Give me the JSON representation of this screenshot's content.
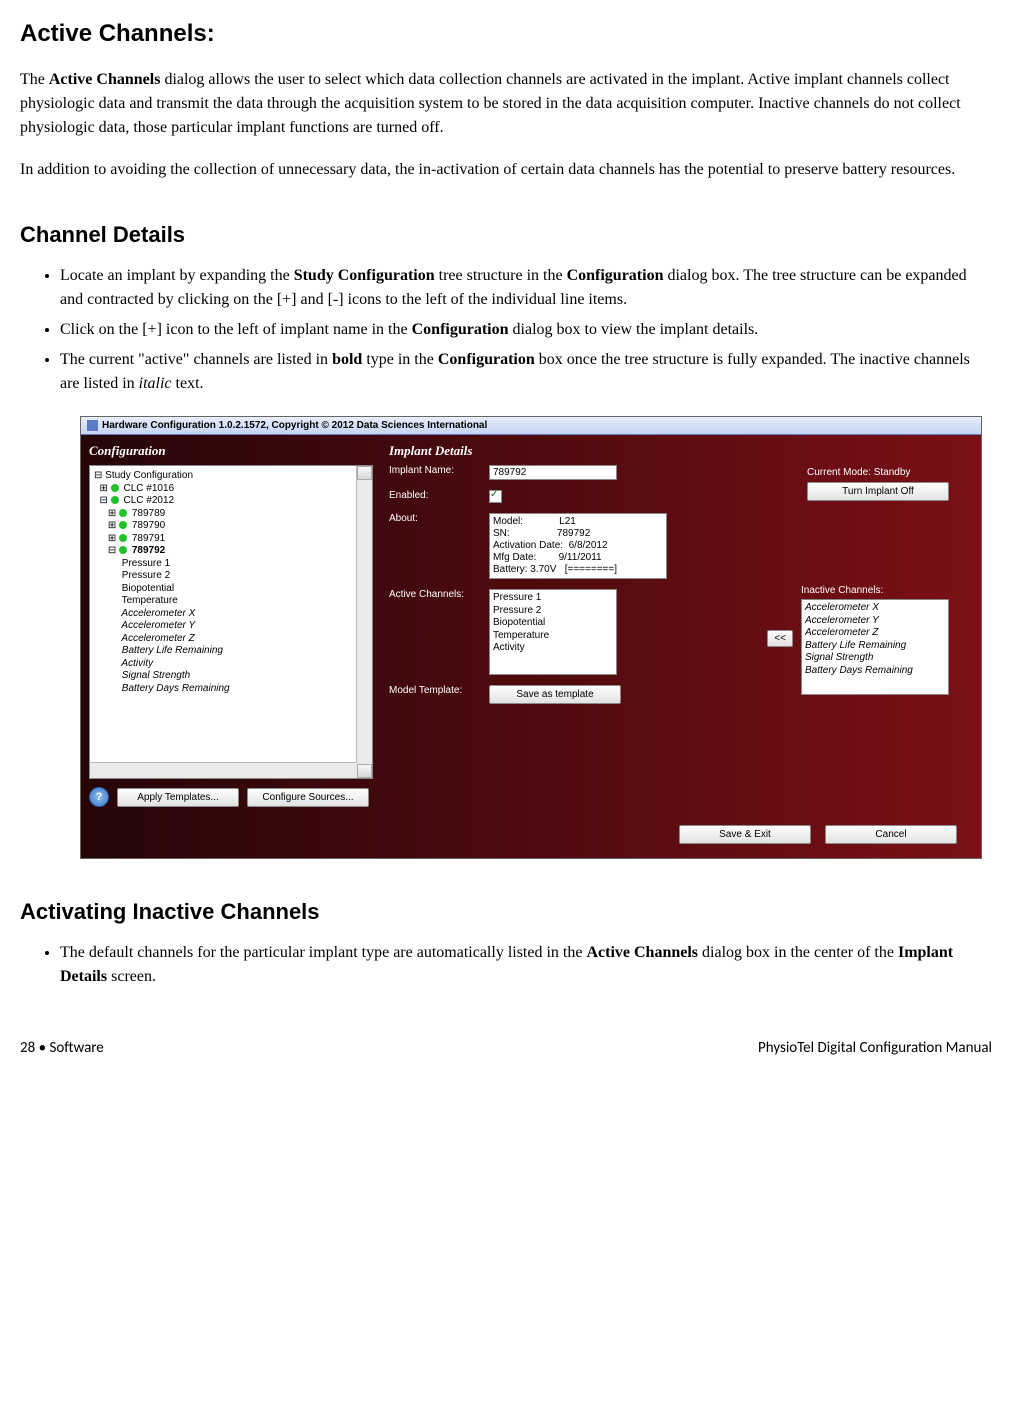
{
  "heading1": "Active Channels:",
  "para1a": "The ",
  "para1b": "Active Channels",
  "para1c": " dialog allows the user to select which data collection channels are activated in the implant.  Active implant channels collect physiologic data and transmit the data through the acquisition system to be stored in the data acquisition computer.  Inactive channels do not collect physiologic data, those particular implant functions are turned off.",
  "para2": "In addition to avoiding the collection of unnecessary data, the in-activation of certain data channels has the potential to preserve battery resources.",
  "heading2": "Channel Details",
  "bullet1a": "Locate an implant by expanding the ",
  "bullet1b": "Study Configuration",
  "bullet1c": " tree structure in the ",
  "bullet1d": "Configuration",
  "bullet1e": " dialog box.   The tree structure can be expanded and contracted by clicking on the [+] and [-] icons to the left of the individual line items.",
  "bullet2a": "Click on the [+] icon to the left of implant name in the ",
  "bullet2b": "Configuration",
  "bullet2c": " dialog box to view the implant details.",
  "bullet3a": "The current \"active\" channels are listed in ",
  "bullet3b": "bold",
  "bullet3c": " type in the ",
  "bullet3d": "Configuration",
  "bullet3e": " box once the tree structure is fully expanded. The inactive channels are listed in ",
  "bullet3f": "italic",
  "bullet3g": " text.",
  "heading3": "Activating Inactive Channels",
  "bullet4a": "The default channels for the particular implant type are automatically listed in the ",
  "bullet4b": "Active Channels",
  "bullet4c": " dialog box in the center of the ",
  "bullet4d": "Implant Details",
  "bullet4e": " screen.",
  "footer_left_a": "28  ",
  "footer_left_b": "•",
  "footer_left_c": "  Software",
  "footer_right": "PhysioTel Digital Configuration Manual",
  "ss": {
    "title": "Hardware Configuration 1.0.2.1572, Copyright © 2012 Data Sciences International",
    "config_label": "Configuration",
    "details_label": "Implant Details",
    "tree": {
      "root": "Study Configuration",
      "clc1": "CLC #1016",
      "clc2": "CLC #2012",
      "imp1": "789789",
      "imp2": "789790",
      "imp3": "789791",
      "imp4": "789792",
      "ch_active": [
        "Pressure 1",
        "Pressure 2",
        "Biopotential",
        "Temperature"
      ],
      "ch_inactive": [
        "Accelerometer X",
        "Accelerometer Y",
        "Accelerometer Z",
        "Battery Life Remaining",
        "Activity",
        "Signal Strength",
        "Battery Days Remaining"
      ]
    },
    "help": "?",
    "btn_apply": "Apply Templates...",
    "btn_configure": "Configure Sources...",
    "labels": {
      "implant_name": "Implant Name:",
      "enabled": "Enabled:",
      "about": "About:",
      "active": "Active Channels:",
      "model_template": "Model Template:",
      "current_mode": "Current Mode: Standby",
      "inactive": "Inactive Channels:"
    },
    "implant_name_value": "789792",
    "about_lines": {
      "model_k": "Model:",
      "model_v": "L21",
      "sn_k": "SN:",
      "sn_v": "789792",
      "act_k": "Activation Date:",
      "act_v": "6/8/2012",
      "mfg_k": "Mfg Date:",
      "mfg_v": "9/11/2011",
      "bat_k": "Battery: 3.70V",
      "bat_v": "[========]"
    },
    "active_list": [
      "Pressure 1",
      "Pressure 2",
      "Biopotential",
      "Temperature",
      "Activity"
    ],
    "inactive_list": [
      "Accelerometer X",
      "Accelerometer Y",
      "Accelerometer Z",
      "Battery Life Remaining",
      "Signal Strength",
      "Battery Days Remaining"
    ],
    "btn_turn_off": "Turn Implant Off",
    "btn_save_tpl": "Save as template",
    "btn_arrow": "<<",
    "btn_save_exit": "Save & Exit",
    "btn_cancel": "Cancel"
  }
}
